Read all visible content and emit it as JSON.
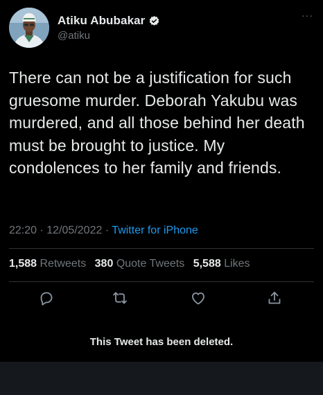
{
  "author": {
    "display_name": "Atiku Abubakar",
    "handle": "@atiku",
    "verified": true
  },
  "tweet": {
    "text": "There can not be a justification for such gruesome murder. Deborah Yakubu was murdered, and all those behind her death must be brought to justice. My condolences to her family and friends.",
    "time": "22:20",
    "separator": "·",
    "date": "12/05/2022",
    "source": "Twitter for iPhone"
  },
  "stats": {
    "retweets_count": "1,588",
    "retweets_label": "Retweets",
    "quote_tweets_count": "380",
    "quote_tweets_label": "Quote Tweets",
    "likes_count": "5,588",
    "likes_label": "Likes"
  },
  "actions": [
    "reply-icon",
    "retweet-icon",
    "like-icon",
    "share-icon"
  ],
  "deleted_notice": "This Tweet has been deleted.",
  "colors": {
    "background": "#000000",
    "text": "#e7e9ea",
    "secondary_text": "#71767b",
    "link": "#1d9bf0",
    "verified_badge": "#e7e9ea"
  }
}
